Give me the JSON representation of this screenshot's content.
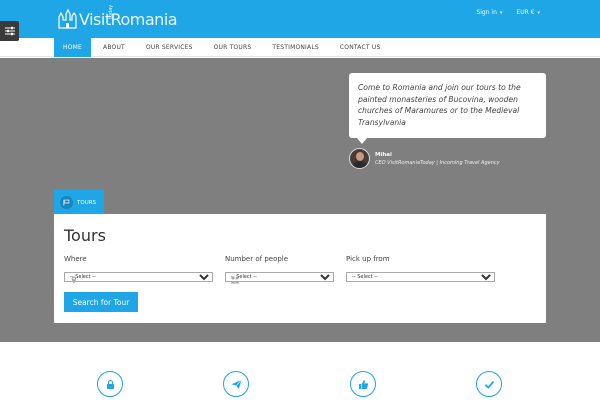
{
  "header": {
    "logo_text": "VisitRomania",
    "logo_sub": "today",
    "signin_label": "Sign in",
    "currency_label": "EUR €"
  },
  "nav": {
    "items": [
      {
        "label": "HOME",
        "active": true
      },
      {
        "label": "ABOUT"
      },
      {
        "label": "OUR SERVICES"
      },
      {
        "label": "OUR TOURS"
      },
      {
        "label": "TESTIMONIALS"
      },
      {
        "label": "CONTACT US"
      }
    ]
  },
  "hero": {
    "quote": "Come to Romania and join our tours to the painted monasteries of Bucovina, wooden churches of Maramures or to the Medieval Transylvania",
    "author_name": "Mihai",
    "author_role": "CEO VisitRomaniaToday | Incoming Travel Agency"
  },
  "search": {
    "tab_label": "TOURS",
    "title": "Tours",
    "where_label": "Where",
    "where_value": "-- Select --",
    "people_label": "Number of people",
    "people_value": "-- Select --",
    "pickup_label": "Pick up from",
    "pickup_value": "-- Select --",
    "button_label": "Search for Tour"
  },
  "features": {
    "icons": [
      "lock-icon",
      "paper-plane-icon",
      "thumbs-up-icon",
      "checkmark-icon"
    ]
  },
  "colors": {
    "accent": "#1ea6e6",
    "hero_bg": "#7f7f7f"
  }
}
